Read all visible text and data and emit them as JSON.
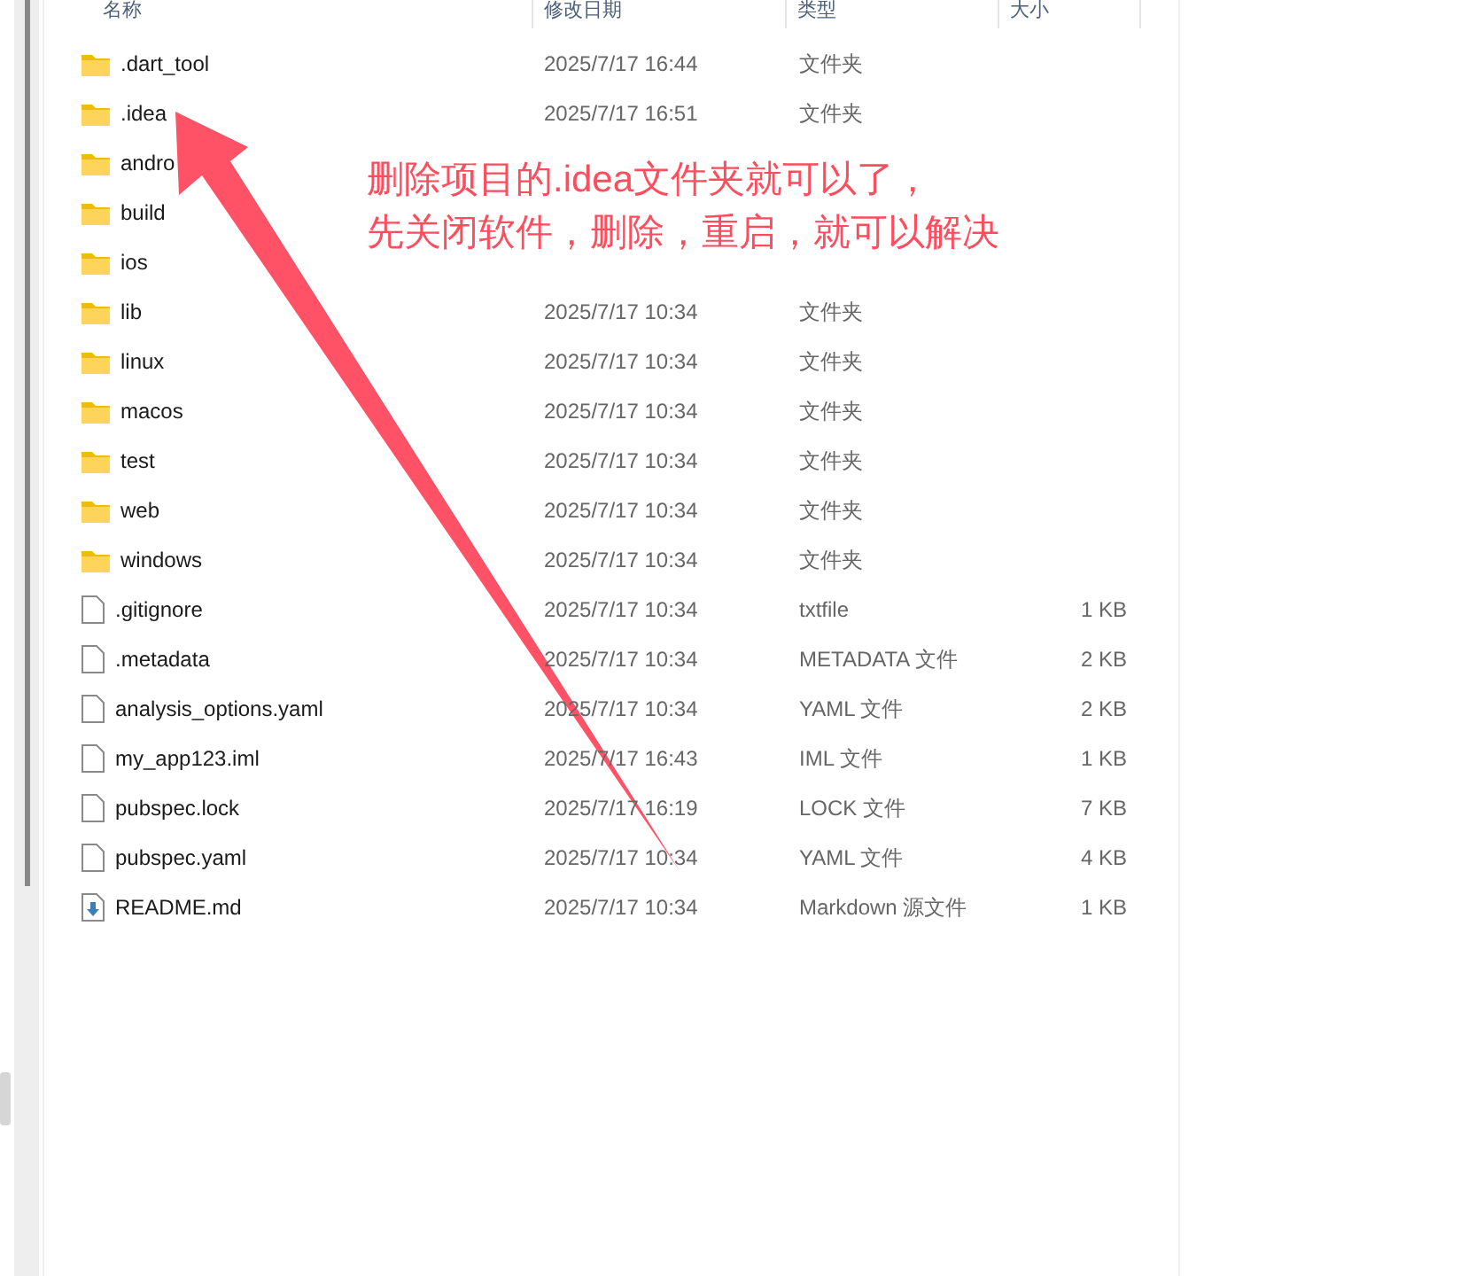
{
  "columns": [
    "名称",
    "修改日期",
    "类型",
    "大小"
  ],
  "rows": [
    {
      "kind": "folder",
      "name": ".dart_tool",
      "date": "2025/7/17 16:44",
      "type": "文件夹"
    },
    {
      "kind": "folder",
      "name": ".idea",
      "date": "2025/7/17 16:51",
      "type": "文件夹"
    },
    {
      "kind": "folder",
      "name": "andro"
    },
    {
      "kind": "folder",
      "name": "build"
    },
    {
      "kind": "folder",
      "name": "ios"
    },
    {
      "kind": "folder",
      "name": "lib",
      "date": "2025/7/17 10:34",
      "type": "文件夹"
    },
    {
      "kind": "folder",
      "name": "linux",
      "date": "2025/7/17 10:34",
      "type": "文件夹"
    },
    {
      "kind": "folder",
      "name": "macos",
      "date": "2025/7/17 10:34",
      "type": "文件夹"
    },
    {
      "kind": "folder",
      "name": "test",
      "date": "2025/7/17 10:34",
      "type": "文件夹"
    },
    {
      "kind": "folder",
      "name": "web",
      "date": "2025/7/17 10:34",
      "type": "文件夹"
    },
    {
      "kind": "folder",
      "name": "windows",
      "date": "2025/7/17 10:34",
      "type": "文件夹"
    },
    {
      "kind": "file",
      "name": ".gitignore",
      "date": "2025/7/17 10:34",
      "type": "txtfile",
      "size": "1 KB"
    },
    {
      "kind": "file",
      "name": ".metadata",
      "date": "2025/7/17 10:34",
      "type": "METADATA 文件",
      "size": "2 KB"
    },
    {
      "kind": "file",
      "name": "analysis_options.yaml",
      "date": "2025/7/17 10:34",
      "type": "YAML 文件",
      "size": "2 KB"
    },
    {
      "kind": "file",
      "name": "my_app123.iml",
      "date": "2025/7/17 16:43",
      "type": "IML 文件",
      "size": "1 KB"
    },
    {
      "kind": "file",
      "name": "pubspec.lock",
      "date": "2025/7/17 16:19",
      "type": "LOCK 文件",
      "size": "7 KB"
    },
    {
      "kind": "file",
      "name": "pubspec.yaml",
      "date": "2025/7/17 10:34",
      "type": "YAML 文件",
      "size": "4 KB"
    },
    {
      "kind": "markdown",
      "name": "README.md",
      "date": "2025/7/17 10:34",
      "type": "Markdown 源文件",
      "size": "1 KB"
    }
  ],
  "annotation": [
    "删除项目的.idea文件夹就可以了，",
    "先关闭软件，删除，重启，就可以解决"
  ]
}
